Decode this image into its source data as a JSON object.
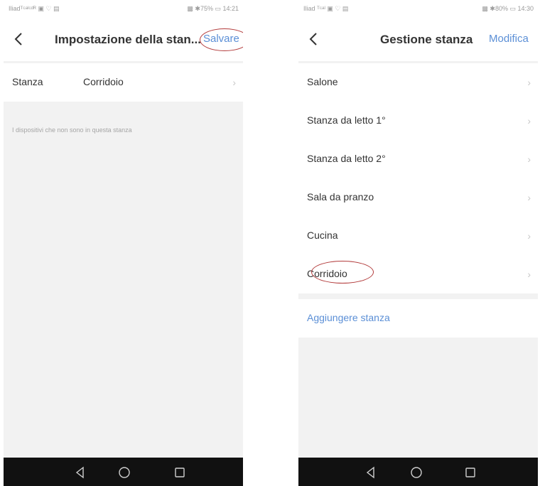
{
  "left_screen": {
    "status_left": "Iliadᵀᶜᵃˡᶜᵈᴿ ▣ ♡ ▤",
    "status_right": "▩ ✱75% ▭ 14:21",
    "title": "Impostazione della stan...",
    "action": "Salvare",
    "room_label": "Stanza",
    "room_value": "Corridoio",
    "hint": "I dispositivi che non sono in questa stanza"
  },
  "right_screen": {
    "status_left": "Iliad ᵀᶜᵃˡ ▣ ♡ ▤",
    "status_right": "▩ ✱80% ▭ 14:30",
    "title": "Gestione stanza",
    "action": "Modifica",
    "rooms": [
      {
        "label": "Salone"
      },
      {
        "label": "Stanza da letto 1°"
      },
      {
        "label": "Stanza da letto 2°"
      },
      {
        "label": "Sala da pranzo"
      },
      {
        "label": "Cucina"
      },
      {
        "label": "Corridoio"
      }
    ],
    "add_room": "Aggiungere stanza"
  },
  "icons": {
    "back": "chevron-left-icon",
    "row_chevron": "chevron-right-icon",
    "system_back": "triangle-back-icon",
    "system_home": "circle-home-icon",
    "system_recent": "square-recent-icon"
  },
  "colors": {
    "accent": "#5b8fd6",
    "annotation": "#b23a3a",
    "background": "#f2f2f2",
    "system_bar": "#111111"
  }
}
